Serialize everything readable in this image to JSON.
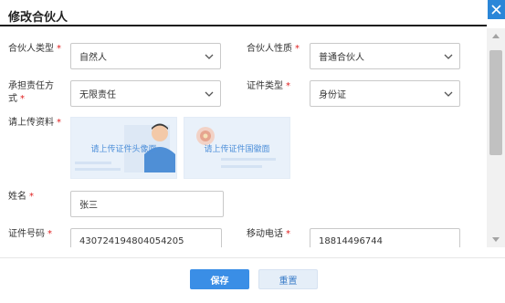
{
  "dialog": {
    "title": "修改合伙人",
    "close_icon": "close-icon"
  },
  "form": {
    "partner_type": {
      "label": "合伙人类型",
      "required_mark": "*",
      "value": "自然人"
    },
    "partner_nature": {
      "label": "合伙人性质",
      "required_mark": "*",
      "value": "普通合伙人"
    },
    "liability": {
      "label_line1": "承担责任方",
      "label_line2": "式",
      "required_mark": "*",
      "value": "无限责任"
    },
    "id_type": {
      "label": "证件类型",
      "required_mark": "*",
      "value": "身份证"
    },
    "upload": {
      "label": "请上传资料",
      "required_mark": "*",
      "portrait_text": "请上传证件头像面",
      "emblem_text": "请上传证件国徽面"
    },
    "name": {
      "label": "姓名",
      "required_mark": "*",
      "value": "张三"
    },
    "id_number": {
      "label": "证件号码",
      "required_mark": "*",
      "value": "430724194804054205"
    },
    "mobile": {
      "label": "移动电话",
      "required_mark": "*",
      "value": "18814496744"
    }
  },
  "footer": {
    "save_label": "保存",
    "reset_label": "重置"
  },
  "colors": {
    "accent": "#3a8ee6",
    "required": "#e02020",
    "upload_bg": "#e9f1fa"
  }
}
